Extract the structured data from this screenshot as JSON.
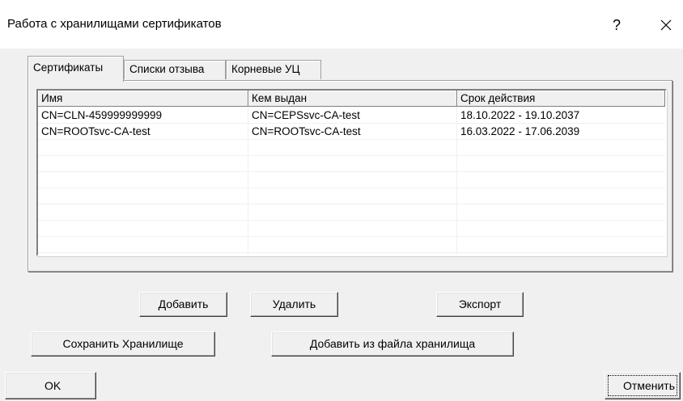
{
  "dialog": {
    "title": "Работа с хранилищами сертификатов",
    "help_label": "?",
    "close_icon": "close-icon"
  },
  "tabs": [
    {
      "label": "Сертификаты",
      "active": true
    },
    {
      "label": "Списки отзыва",
      "active": false
    },
    {
      "label": "Корневые УЦ",
      "active": false
    }
  ],
  "list": {
    "columns": [
      "Имя",
      "Кем выдан",
      "Срок действия"
    ],
    "rows": [
      [
        "CN=CLN-459999999999",
        "CN=CEPSsvc-CA-test",
        "18.10.2022 - 19.10.2037"
      ],
      [
        "CN=ROOTsvc-CA-test",
        "CN=ROOTsvc-CA-test",
        "16.03.2022 - 17.06.2039"
      ]
    ]
  },
  "buttons": {
    "add": "Добавить",
    "delete": "Удалить",
    "export": "Экспорт",
    "save_store": "Сохранить Хранилище",
    "add_from_file": "Добавить из файла хранилища",
    "ok": "OK",
    "cancel": "Отменить"
  }
}
